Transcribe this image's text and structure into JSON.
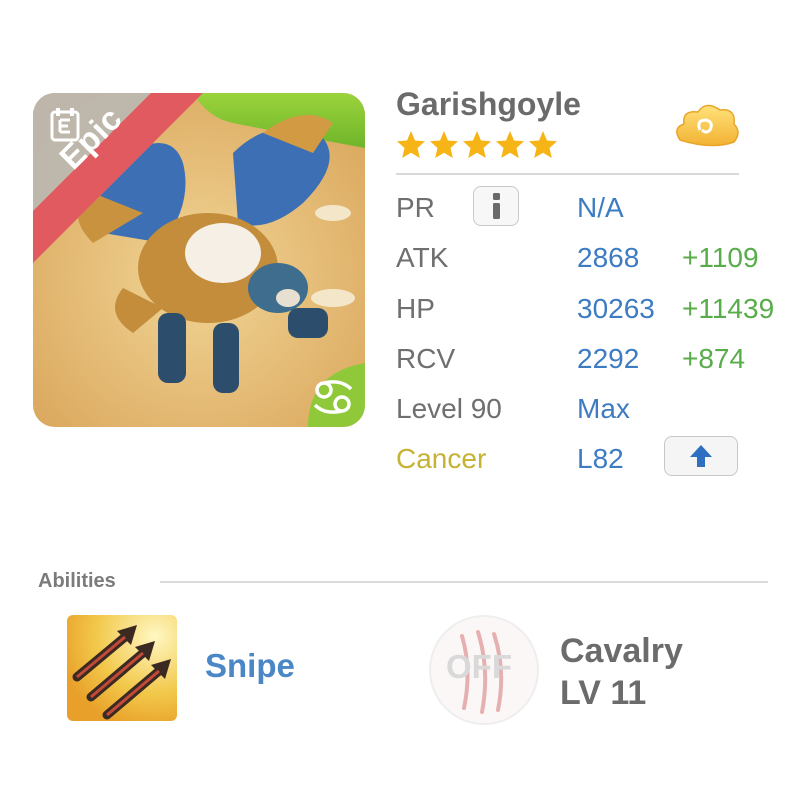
{
  "monster": {
    "name": "Garishgoyle",
    "rarity": "Epic",
    "star_count": 5,
    "rank_icon": "book-icon",
    "zodiac_icon": "cancer-icon",
    "element_icon": "cloud-icon"
  },
  "stats": {
    "pr": {
      "label": "PR",
      "value": "N/A"
    },
    "atk": {
      "label": "ATK",
      "value": "2868",
      "bonus": "+1109"
    },
    "hp": {
      "label": "HP",
      "value": "30263",
      "bonus": "+11439"
    },
    "rcv": {
      "label": "RCV",
      "value": "2292",
      "bonus": "+874"
    },
    "level": {
      "label": "Level 90",
      "value": "Max"
    },
    "sign": {
      "label": "Cancer",
      "value": "L82"
    }
  },
  "abilities": {
    "title": "Abilities",
    "primary": {
      "name": "Snipe",
      "icon": "arrows-icon"
    },
    "secondary": {
      "status": "OFF",
      "name": "Cavalry",
      "level": "LV 11",
      "icon": "claw-icon"
    }
  },
  "colors": {
    "stat_value": "#3d7cc3",
    "stat_bonus": "#58ac4a",
    "sign_label": "#c6b233",
    "star": "#f6b417",
    "epic_ribbon": "#e05a5f"
  }
}
